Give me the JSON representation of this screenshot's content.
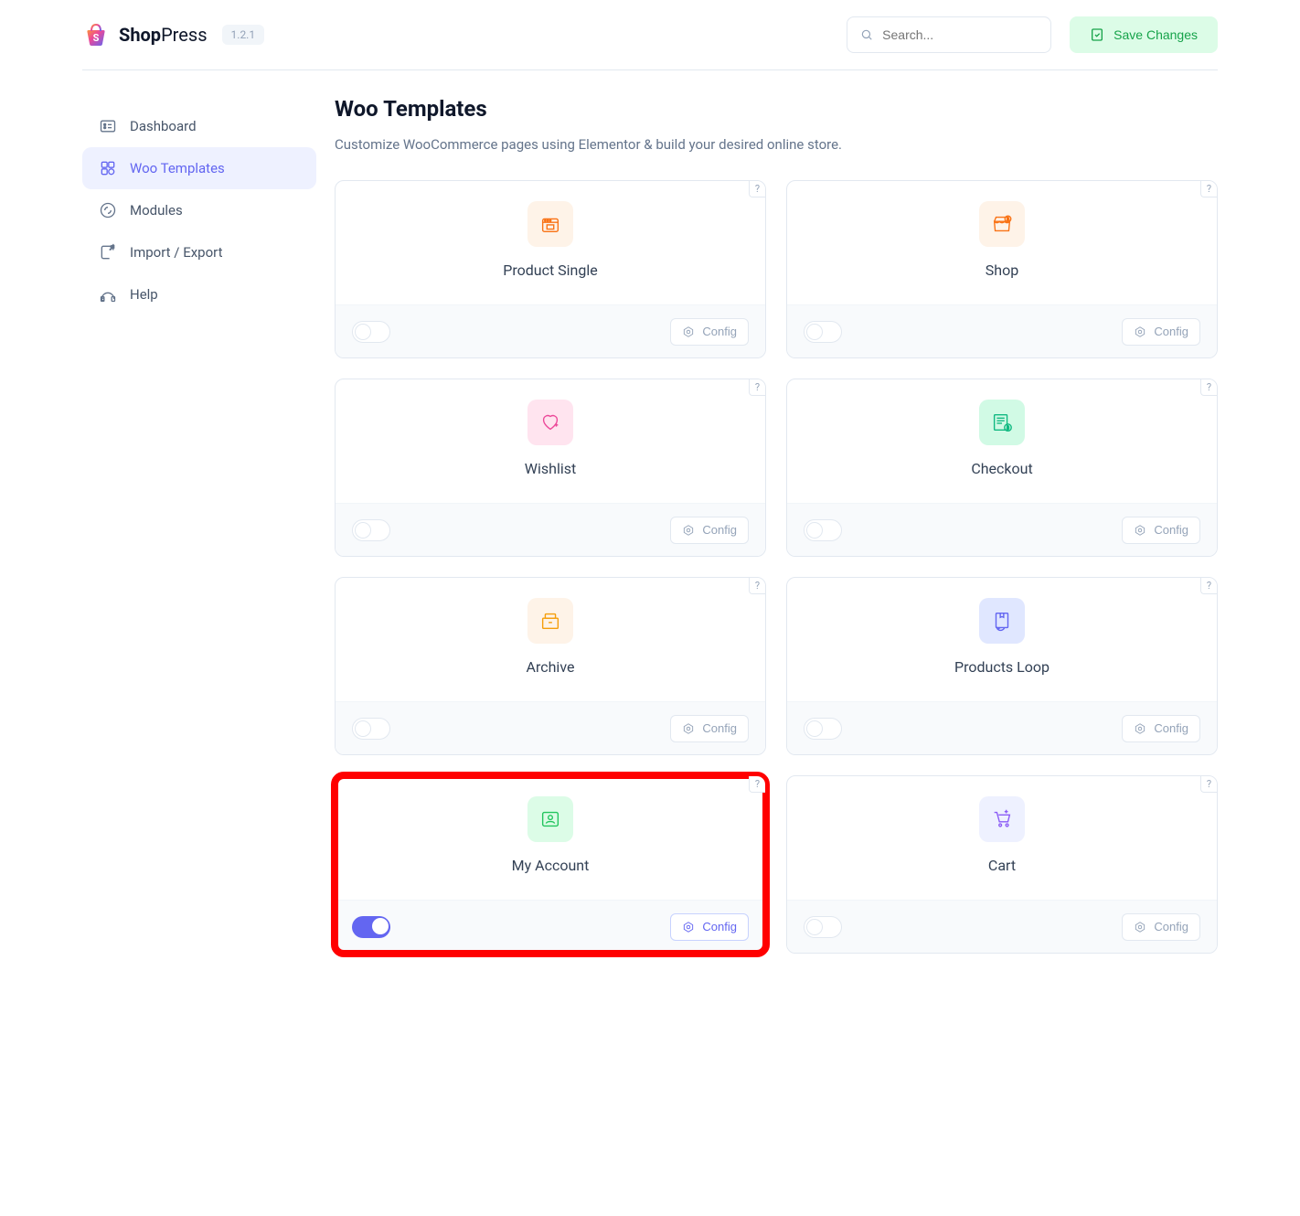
{
  "brand": {
    "name_a": "Shop",
    "name_b": "Press",
    "version": "1.2.1"
  },
  "search": {
    "placeholder": "Search..."
  },
  "save_label": "Save Changes",
  "nav": [
    {
      "id": "dashboard",
      "label": "Dashboard"
    },
    {
      "id": "woo-templates",
      "label": "Woo Templates"
    },
    {
      "id": "modules",
      "label": "Modules"
    },
    {
      "id": "import-export",
      "label": "Import / Export"
    },
    {
      "id": "help",
      "label": "Help"
    }
  ],
  "page_title": "Woo Templates",
  "page_subtitle": "Customize WooCommerce pages using Elementor & build your desired online store.",
  "config_label": "Config",
  "help_q": "?",
  "cards": [
    {
      "id": "product-single",
      "title": "Product Single",
      "on": false,
      "highlight": false,
      "bg": "#fef3e8"
    },
    {
      "id": "shop",
      "title": "Shop",
      "on": false,
      "highlight": false,
      "bg": "#fef3e8"
    },
    {
      "id": "wishlist",
      "title": "Wishlist",
      "on": false,
      "highlight": false,
      "bg": "#ffe4ef"
    },
    {
      "id": "checkout",
      "title": "Checkout",
      "on": false,
      "highlight": false,
      "bg": "#d1fae5"
    },
    {
      "id": "archive",
      "title": "Archive",
      "on": false,
      "highlight": false,
      "bg": "#fef3e8"
    },
    {
      "id": "products-loop",
      "title": "Products Loop",
      "on": false,
      "highlight": false,
      "bg": "#e0e7ff"
    },
    {
      "id": "my-account",
      "title": "My Account",
      "on": true,
      "highlight": true,
      "bg": "#dcfce7"
    },
    {
      "id": "cart",
      "title": "Cart",
      "on": false,
      "highlight": false,
      "bg": "#eef1ff"
    }
  ]
}
